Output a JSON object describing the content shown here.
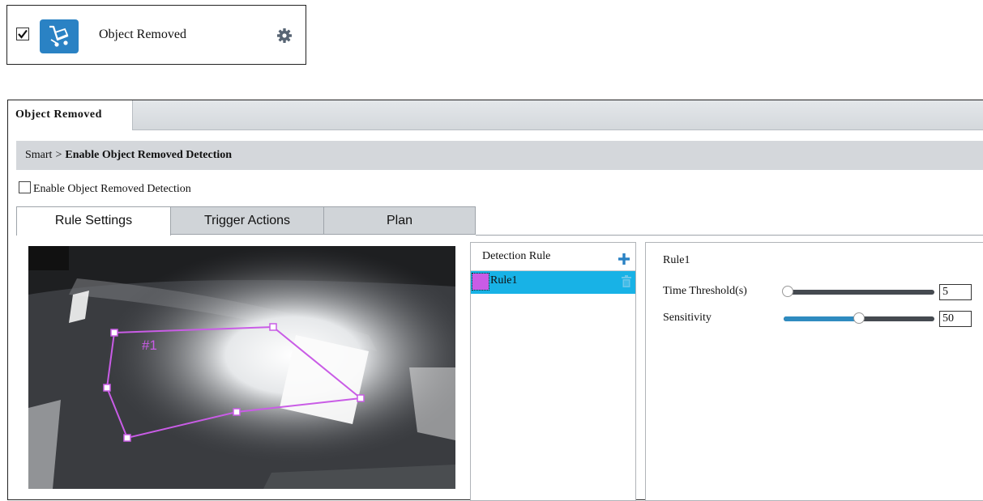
{
  "feature_card": {
    "enabled": true,
    "title": "Object Removed",
    "icon": "cart-remove-icon",
    "settings_icon": "gear-icon"
  },
  "panel": {
    "tab_title": "Object Removed",
    "breadcrumb": {
      "root": "Smart",
      "separator": ">",
      "current": "Enable Object Removed Detection"
    },
    "enable_label": "Enable Object Removed Detection",
    "enable_checked": false,
    "subtabs": [
      {
        "label": "Rule Settings",
        "active": true
      },
      {
        "label": "Trigger Actions",
        "active": false
      },
      {
        "label": "Plan",
        "active": false
      }
    ]
  },
  "video": {
    "region_label": "#1",
    "region_color": "#c95ce6"
  },
  "detection_rule": {
    "header": "Detection Rule",
    "rules": [
      {
        "name": "Rule1",
        "color": "#c95ce6",
        "selected": true
      }
    ]
  },
  "settings": {
    "rule_name": "Rule1",
    "time_threshold": {
      "label": "Time Threshold(s)",
      "value": "5",
      "fraction": 0.0
    },
    "sensitivity": {
      "label": "Sensitivity",
      "value": "50",
      "fraction": 0.5
    }
  },
  "colors": {
    "accent": "#2a82c4",
    "selected_row": "#18b2e6",
    "slider_fill": "#2f8bc0"
  }
}
